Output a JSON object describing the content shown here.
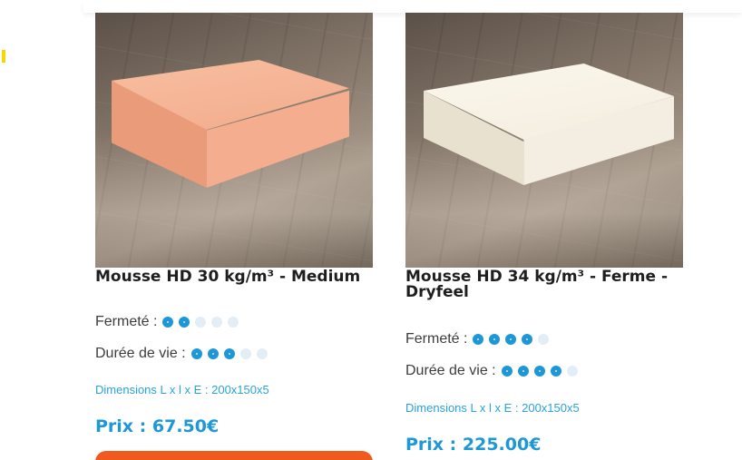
{
  "colors": {
    "accent_blue": "#1e97d6",
    "dimension_blue": "#29a3db",
    "cart_orange": "#f05a1e",
    "dot_empty": "#e3edf6",
    "title_text": "#1e1e1e"
  },
  "products": [
    {
      "title": "Mousse HD 30 kg/m³ - Medium",
      "image_icon": "peach-foam-block-image",
      "firmness_label": "Fermeté :",
      "firmness_rating": 2,
      "firmness_max": 5,
      "lifespan_label": "Durée de vie :",
      "lifespan_rating": 3,
      "lifespan_max": 5,
      "dimensions": "Dimensions L x l x E : 200x150x5",
      "price": "Prix : 67.50€"
    },
    {
      "title": "Mousse HD 34 kg/m³ - Ferme - Dryfeel",
      "image_icon": "white-foam-block-image",
      "firmness_label": "Fermeté :",
      "firmness_rating": 4,
      "firmness_max": 5,
      "lifespan_label": "Durée de vie :",
      "lifespan_rating": 4,
      "lifespan_max": 5,
      "dimensions": "Dimensions L x l x E : 200x150x5",
      "price": "Prix : 225.00€"
    }
  ]
}
